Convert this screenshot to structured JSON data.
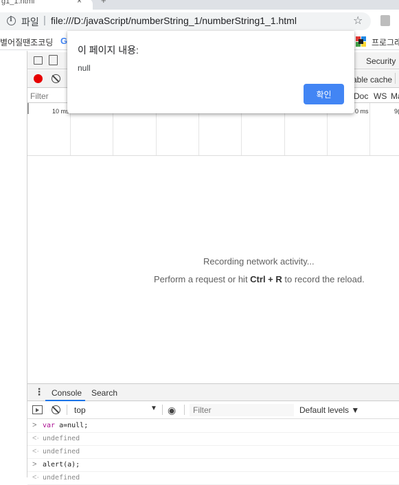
{
  "browser": {
    "tab_title": "g1_1.html",
    "tab_close": "×",
    "new_tab": "+",
    "address_scheme": "파일",
    "address_separator": "|",
    "url": "file:///D:/javaScript/numberString_1/numberString1_1.html",
    "star_glyph": "☆",
    "bookmarks": [
      "별어질땐조코딩",
      "프로그래"
    ],
    "bookmark_g": "G"
  },
  "devtools": {
    "panel_tab": "Security",
    "disable_cache": "able cache",
    "filter_placeholder": "Filter",
    "types": [
      "Doc",
      "WS",
      "Ma"
    ],
    "timeline_labels": [
      "10 ms",
      "0 ms",
      "9("
    ],
    "empty_line1": "Recording network activity...",
    "empty_line2_prefix": "Perform a request or hit ",
    "empty_line2_key": "Ctrl + R",
    "empty_line2_suffix": " to record the reload."
  },
  "drawer": {
    "menu_glyph": "⋮",
    "tabs": [
      "Console",
      "Search"
    ],
    "context": "top",
    "context_arrow": "▼",
    "eye_glyph": "◉",
    "filter_placeholder": "Filter",
    "levels": "Default levels ▼",
    "logs": [
      {
        "prompt": ">",
        "keyword": "var",
        "text": " a=null;"
      },
      {
        "prompt": "<·",
        "text": "undefined"
      },
      {
        "prompt": "<·",
        "text": "undefined"
      },
      {
        "prompt": ">",
        "text": "alert(a);"
      },
      {
        "prompt": "<·",
        "text": "undefined"
      }
    ]
  },
  "dialog": {
    "title": "이 페이지 내용:",
    "message": "null",
    "ok_label": "확인"
  },
  "colors": {
    "accent": "#4285f4",
    "record": "#e60000",
    "console_tab_underline": "#1a73e8"
  }
}
